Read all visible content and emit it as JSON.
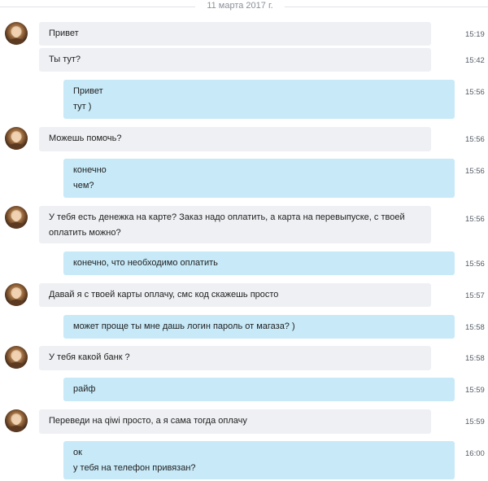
{
  "date_separator": "11 марта 2017 г.",
  "messages": [
    {
      "side": "in",
      "lines": [
        "Привет"
      ],
      "time": "15:19"
    },
    {
      "side": "in",
      "lines": [
        "Ты тут?"
      ],
      "time": "15:42"
    },
    {
      "side": "out",
      "lines": [
        "Привет",
        "тут )"
      ],
      "time": "15:56"
    },
    {
      "side": "in",
      "lines": [
        "Можешь помочь?"
      ],
      "time": "15:56"
    },
    {
      "side": "out",
      "lines": [
        "конечно",
        "чем?"
      ],
      "time": "15:56"
    },
    {
      "side": "in",
      "lines": [
        "У тебя есть денежка на карте? Заказ надо оплатить, а карта на перевыпуске, с твоей оплатить можно?"
      ],
      "time": "15:56"
    },
    {
      "side": "out",
      "lines": [
        "конечно, что необходимо оплатить"
      ],
      "time": "15:56"
    },
    {
      "side": "in",
      "lines": [
        "Давай я с твоей карты оплачу, смс код скажешь просто"
      ],
      "time": "15:57"
    },
    {
      "side": "out",
      "lines": [
        "может проще ты мне дашь логин пароль от магаза? )"
      ],
      "time": "15:58"
    },
    {
      "side": "in",
      "lines": [
        "У тебя какой банк ?"
      ],
      "time": "15:58"
    },
    {
      "side": "out",
      "lines": [
        "райф"
      ],
      "time": "15:59"
    },
    {
      "side": "in",
      "lines": [
        "Переведи на qiwi просто, а я сама тогда оплачу"
      ],
      "time": "15:59"
    },
    {
      "side": "out",
      "lines": [
        "ок",
        "у тебя на телефон привязан?"
      ],
      "time": "16:00"
    }
  ]
}
